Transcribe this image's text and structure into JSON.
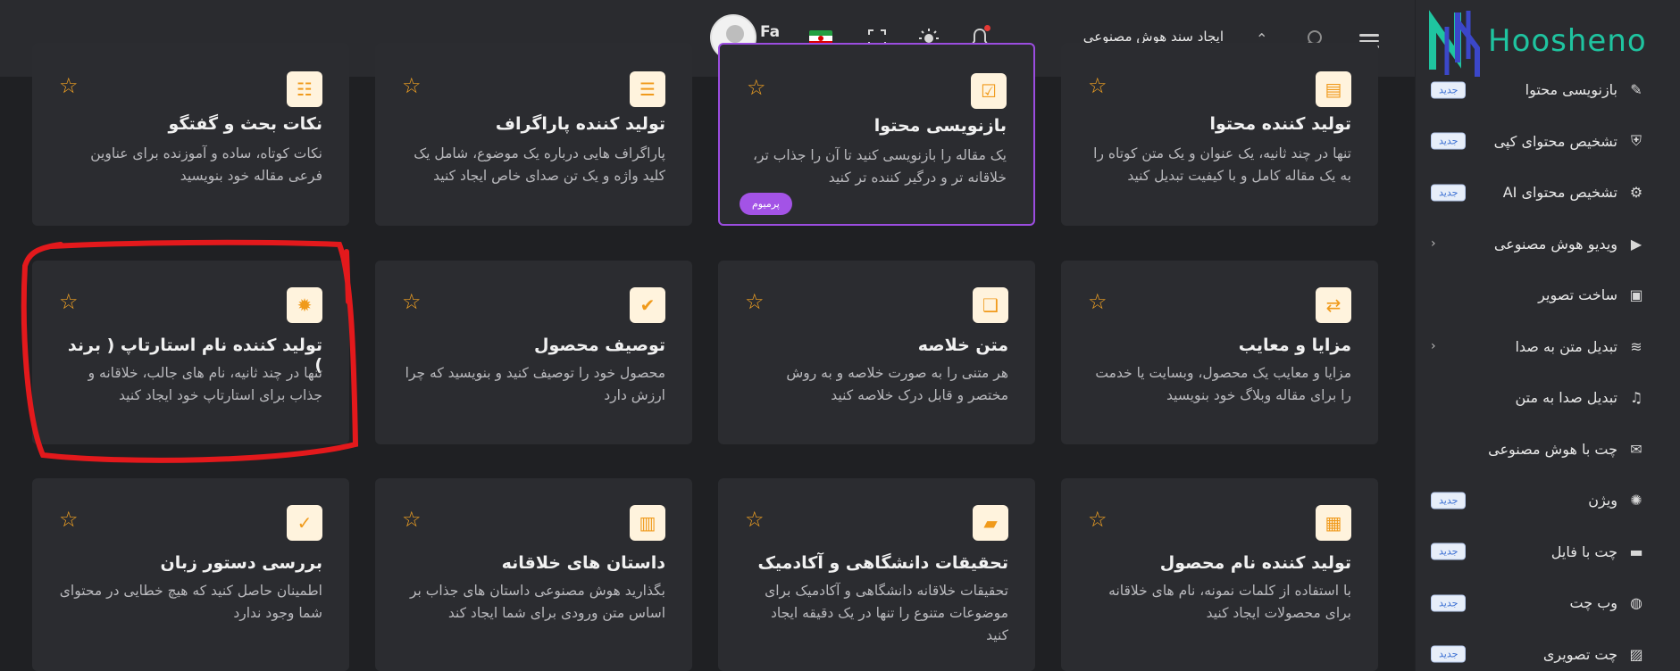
{
  "brand": {
    "name": "Hoosheno"
  },
  "header": {
    "title": "ایجاد سند هوش مصنوعی",
    "language": "Fa"
  },
  "sidebar": {
    "items": [
      {
        "label": "بازنویسی محتوا",
        "icon": "pen-icon",
        "badge": "جدید"
      },
      {
        "label": "تشخیص محتوای کپی",
        "icon": "shield-check-icon",
        "badge": "جدید"
      },
      {
        "label": "تشخیص محتوای AI",
        "icon": "robot-icon",
        "badge": "جدید"
      },
      {
        "label": "ویدیو هوش مصنوعی",
        "icon": "video-icon",
        "chevron": "‹"
      },
      {
        "label": "ساخت تصویر",
        "icon": "image-scan-icon"
      },
      {
        "label": "تبدیل متن به صدا",
        "icon": "sound-wave-icon",
        "chevron": "‹"
      },
      {
        "label": "تبدیل صدا به متن",
        "icon": "audio-file-icon"
      },
      {
        "label": "چت با هوش مصنوعی",
        "icon": "chat-icon"
      },
      {
        "label": "ویژن",
        "icon": "brain-icon",
        "badge": "جدید"
      },
      {
        "label": "چت با فایل",
        "icon": "folder-icon",
        "badge": "جدید"
      },
      {
        "label": "وب چت",
        "icon": "globe-icon",
        "badge": "جدید"
      },
      {
        "label": "چت تصویری",
        "icon": "picture-icon",
        "badge": "جدید"
      }
    ]
  },
  "cards": [
    {
      "title": "تولید کننده محتوا",
      "desc": "تنها در چند ثانیه، یک عنوان و یک متن کوتاه را به یک مقاله کامل و با کیفیت تبدیل کنید",
      "icon": "document-icon"
    },
    {
      "title": "بازنویسی محتوا",
      "desc": "یک مقاله را بازنویسی کنید تا آن را جذاب تر، خلاقانه تر و درگیر کننده تر کنید",
      "icon": "checkbox-icon",
      "premium": "پرمیوم"
    },
    {
      "title": "تولید کننده پاراگراف",
      "desc": "پاراگراف هایی درباره یک موضوع، شامل یک کلید واژه و یک تن صدای خاص ایجاد کنید",
      "icon": "paragraph-icon"
    },
    {
      "title": "نکات بحث و گفتگو",
      "desc": "نکات کوتاه، ساده و آموزنده برای عناوین فرعی مقاله خود بنویسید",
      "icon": "list-icon"
    },
    {
      "title": "مزایا و معایب",
      "desc": "مزایا و معایب یک محصول، وبسایت یا خدمت را برای مقاله وبلاگ خود بنویسید",
      "icon": "exchange-icon"
    },
    {
      "title": "متن خلاصه",
      "desc": "هر متنی را به صورت خلاصه و به روش مختصر و قابل درک خلاصه کنید",
      "icon": "file-icon"
    },
    {
      "title": "توصیف محصول",
      "desc": "محصول خود را توصیف کنید و بنویسید که چرا ارزش دارد",
      "icon": "checklist-icon"
    },
    {
      "title": "تولید کننده نام استارتاپ ( برند )",
      "desc": "تنها در چند ثانیه، نام های جالب، خلاقانه و جذاب برای استارتاپ خود ایجاد کنید",
      "icon": "lightbulb-icon"
    },
    {
      "title": "تولید کننده نام محصول",
      "desc": "با استفاده از کلمات نمونه، نام های خلاقانه برای محصولات ایجاد کنید",
      "icon": "box-icon"
    },
    {
      "title": "تحقیقات دانشگاهی و آکادمیک",
      "desc": "تحقیقات خلاقانه دانشگاهی و آکادمیک برای موضوعات متنوع را تنها در یک دقیقه ایجاد کنید",
      "icon": "scroll-icon"
    },
    {
      "title": "داستان های خلاقانه",
      "desc": "بگذارید هوش مصنوعی داستان های جذاب بر اساس متن ورودی برای شما ایجاد کند",
      "icon": "books-icon"
    },
    {
      "title": "بررسی دستور زبان",
      "desc": "اطمینان حاصل کنید که هیچ خطایی در محتوای شما وجود ندارد",
      "icon": "spellcheck-icon"
    }
  ],
  "colors": {
    "accent": "#f4a322",
    "premium": "#a353e6",
    "brand": "#1fc4a0",
    "highlight": "#e3191c"
  }
}
